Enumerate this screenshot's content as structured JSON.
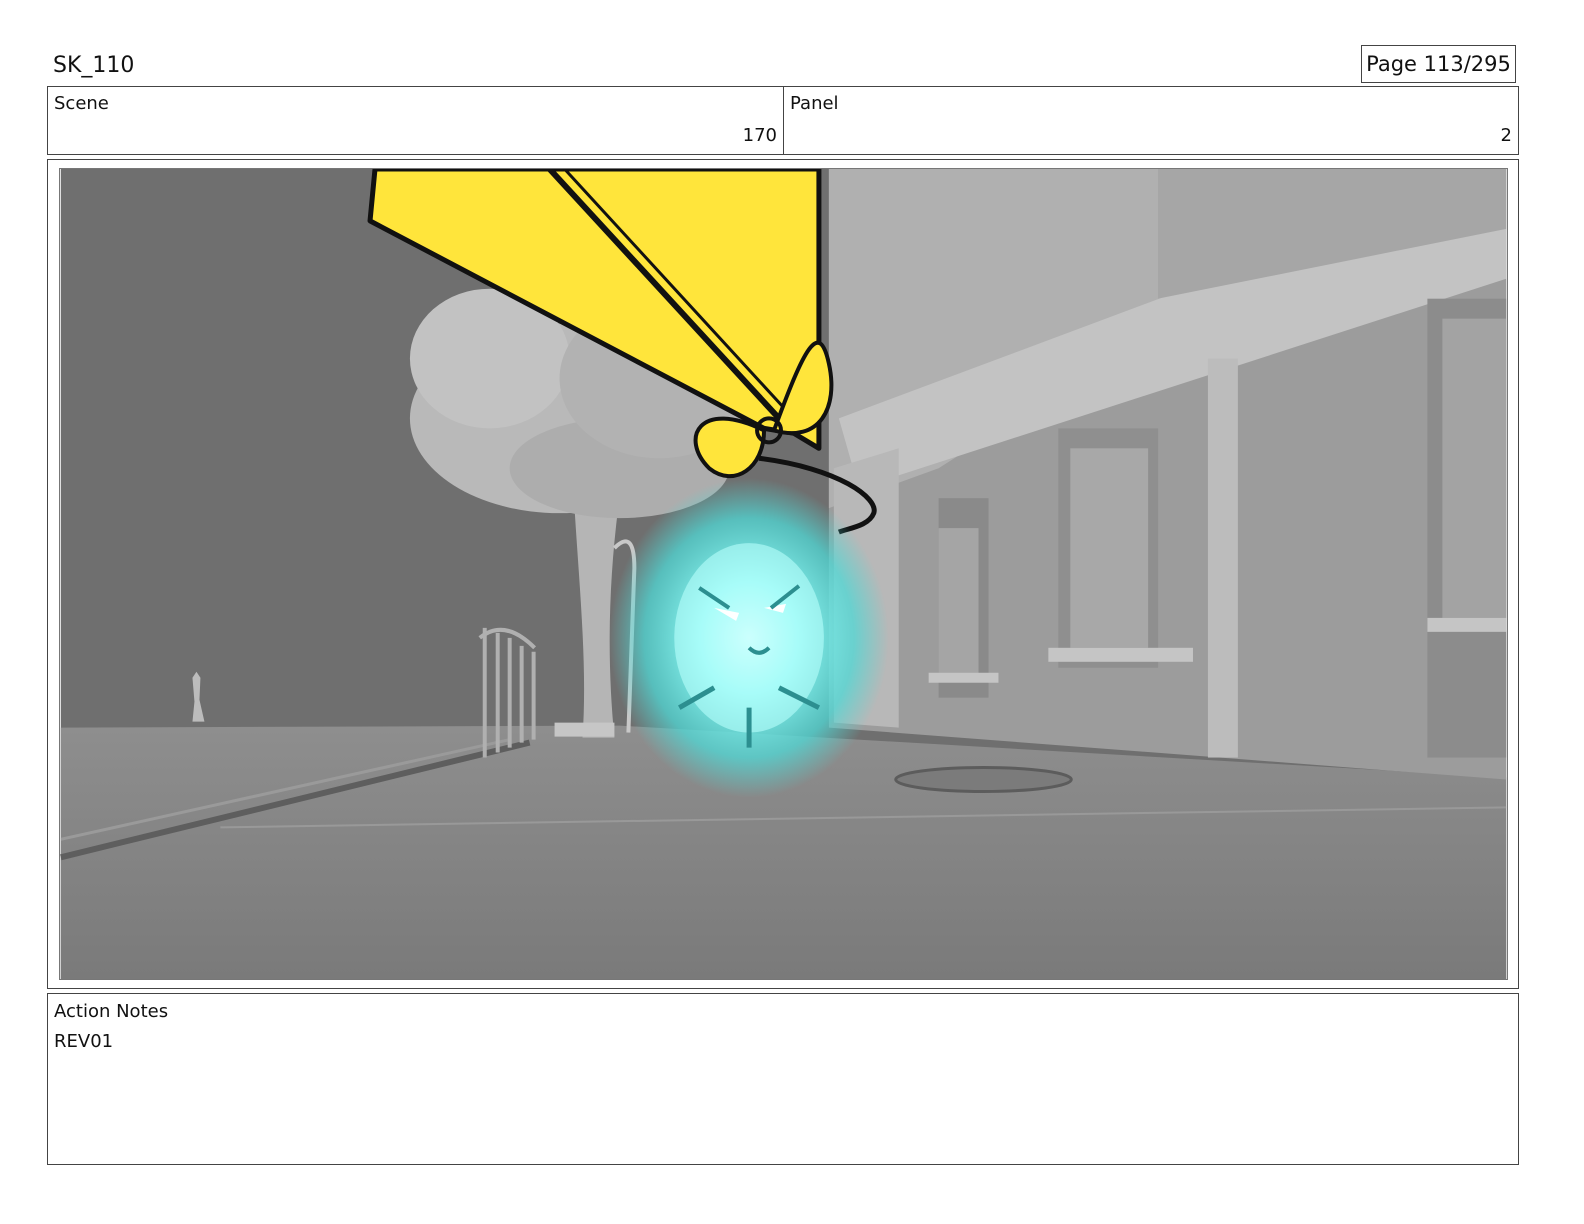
{
  "header": {
    "title": "SK_110",
    "page": "Page 113/295"
  },
  "info": {
    "scene_label": "Scene",
    "scene_value": "170",
    "panel_label": "Panel",
    "panel_value": "2"
  },
  "frame": {
    "colors": {
      "sky": "#6f6f6f",
      "building": "#9c9c9c",
      "ground": "#858585",
      "kite": "#ffe53b",
      "glow": "#5ff3f0"
    }
  },
  "notes": {
    "label": "Action Notes",
    "text": "REV01"
  }
}
